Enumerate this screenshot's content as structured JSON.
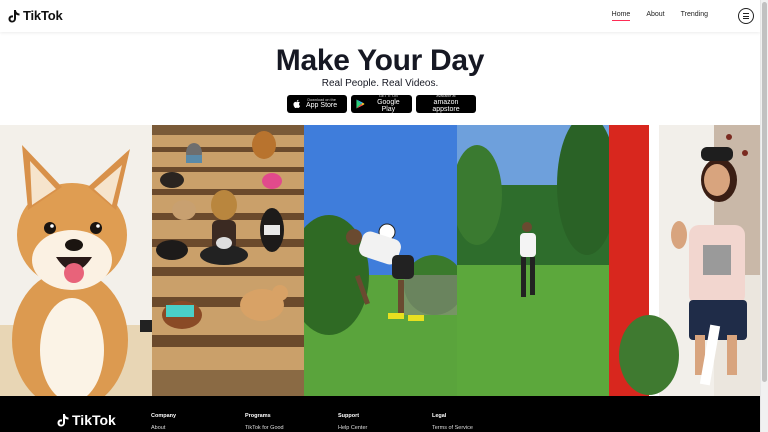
{
  "header": {
    "brand": "TikTok",
    "nav": [
      {
        "label": "Home",
        "active": true
      },
      {
        "label": "About",
        "active": false
      },
      {
        "label": "Trending",
        "active": false
      }
    ],
    "menu_icon": "hamburger-icon"
  },
  "hero": {
    "title": "Make Your Day",
    "subtitle": "Real People. Real Videos.",
    "stores": [
      {
        "small": "Download on the",
        "big": "App Store",
        "icon": "apple-icon"
      },
      {
        "small": "GET IT ON",
        "big": "Google Play",
        "icon": "google-play-icon"
      },
      {
        "small": "available at",
        "big": "amazon appstore",
        "icon": "amazon-icon"
      }
    ]
  },
  "gallery": {
    "panels": [
      {
        "subject": "shiba dog"
      },
      {
        "subject": "dogs on stairs"
      },
      {
        "subject": "soccer juggling"
      },
      {
        "subject": "person in field"
      },
      {
        "subject": "woman waving"
      }
    ]
  },
  "footer": {
    "brand": "TikTok",
    "columns": [
      {
        "heading": "Company",
        "item": "About"
      },
      {
        "heading": "Programs",
        "item": "TikTok for Good"
      },
      {
        "heading": "Support",
        "item": "Help Center"
      },
      {
        "heading": "Legal",
        "item": "Terms of Service"
      }
    ]
  },
  "colors": {
    "accent": "#fe2c55",
    "cyan": "#25f4ee",
    "footer_bg": "#000000"
  }
}
